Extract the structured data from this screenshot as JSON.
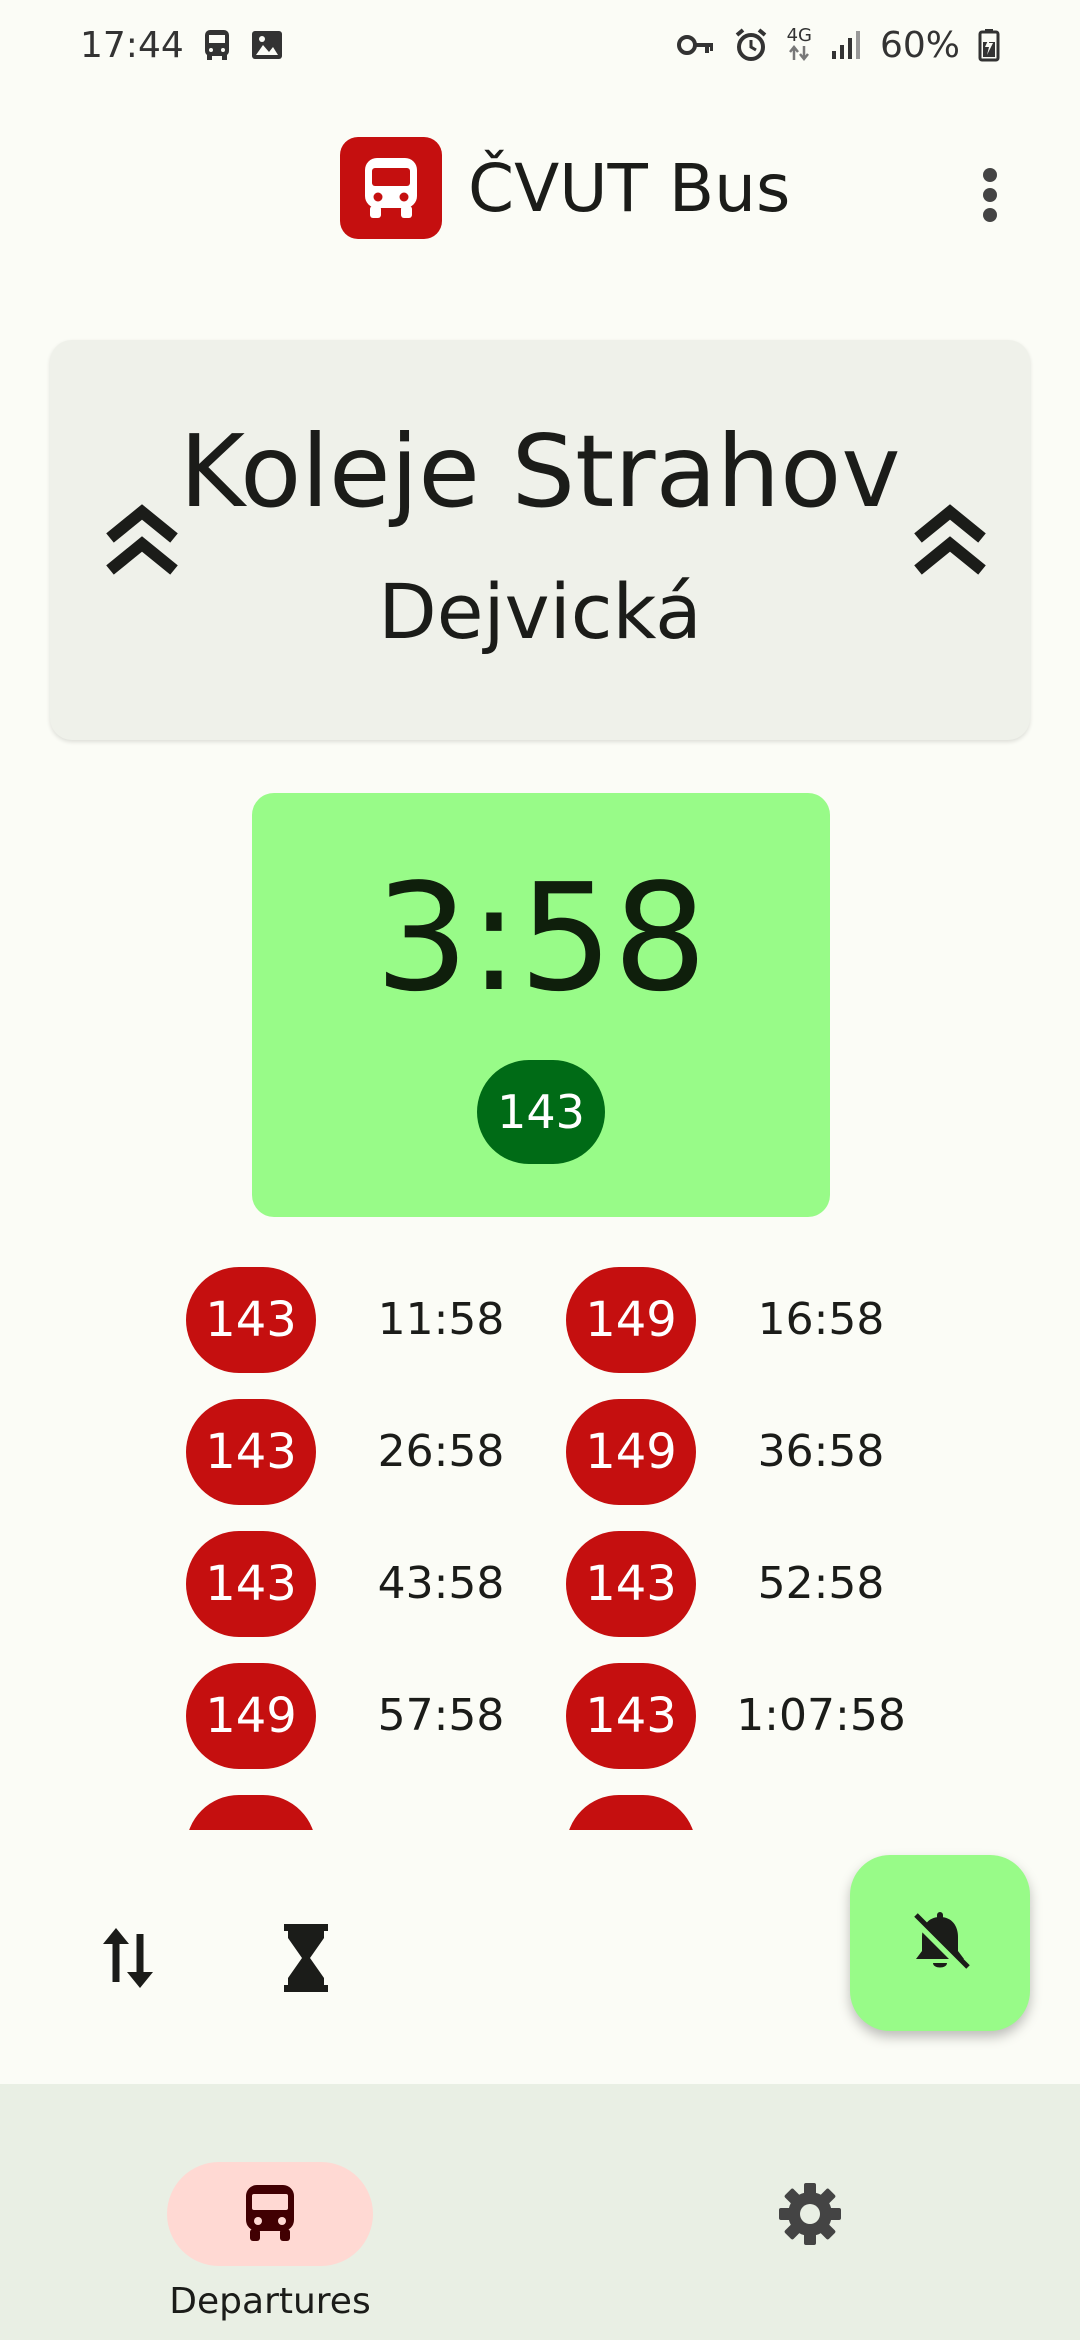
{
  "status_bar": {
    "time": "17:44",
    "network": "4G",
    "battery": "60%",
    "left_icons": [
      "bus-notification-icon",
      "image-notification-icon"
    ],
    "right_icons": [
      "vpn-key-icon",
      "alarm-icon",
      "data-arrows-icon",
      "signal-icon",
      "battery-charging-icon"
    ]
  },
  "app_bar": {
    "title": "ČVUT Bus",
    "logo_icon": "bus-icon",
    "menu_icon": "more-vert-icon"
  },
  "route": {
    "from": "Koleje Strahov",
    "to": "Dejvická",
    "swap_icon": "double-chevron-up-icon"
  },
  "next_departure": {
    "countdown": "3:58",
    "line": "143"
  },
  "departures": [
    {
      "line": "143",
      "time": "11:58"
    },
    {
      "line": "149",
      "time": "16:58"
    },
    {
      "line": "143",
      "time": "26:58"
    },
    {
      "line": "149",
      "time": "36:58"
    },
    {
      "line": "143",
      "time": "43:58"
    },
    {
      "line": "143",
      "time": "52:58"
    },
    {
      "line": "149",
      "time": "57:58"
    },
    {
      "line": "143",
      "time": "1:07:58"
    },
    {
      "line": "",
      "time": ""
    },
    {
      "line": "",
      "time": ""
    }
  ],
  "tools": {
    "swap_icon": "swap-vert-icon",
    "timer_icon": "hourglass-icon",
    "fab_icon": "notifications-off-icon"
  },
  "bottom_nav": {
    "items": [
      {
        "label": "Departures",
        "icon": "bus-icon",
        "active": true
      },
      {
        "label": "",
        "icon": "settings-icon",
        "active": false
      }
    ]
  },
  "colors": {
    "background": "#fbfcf6",
    "brand_red": "#c50f0f",
    "next_card_green": "#98fb88",
    "next_badge_green": "#006b16",
    "nav_active_pill": "#ffd9d3",
    "nav_background": "#e9efe4",
    "route_card": "#eff1ea"
  }
}
